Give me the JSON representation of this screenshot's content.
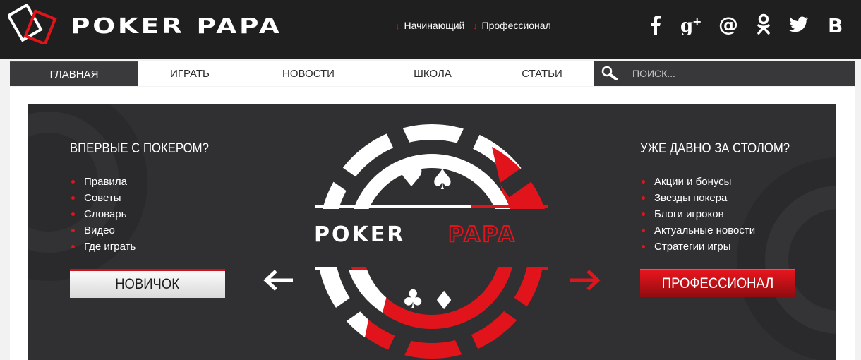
{
  "header": {
    "brand": "POKER PAPA",
    "links": [
      {
        "label": "Начинающий"
      },
      {
        "label": "Профессионал"
      }
    ],
    "social": [
      "facebook-icon",
      "google-plus-icon",
      "mail-at-icon",
      "odnoklassniki-icon",
      "twitter-icon",
      "vk-icon"
    ]
  },
  "nav": {
    "items": [
      {
        "label": "ГЛАВНАЯ",
        "active": true
      },
      {
        "label": "ИГРАТЬ"
      },
      {
        "label": "НОВОСТИ"
      },
      {
        "label": "ШКОЛА"
      },
      {
        "label": "СТАТЬИ"
      }
    ],
    "search_placeholder": "ПОИСК..."
  },
  "hero": {
    "left": {
      "title": "ВПЕРВЫЕ С ПОКЕРОМ?",
      "items": [
        "Правила",
        "Советы",
        "Словарь",
        "Видео",
        "Где играть"
      ],
      "button": "НОВИЧОК"
    },
    "center_logo": {
      "word1": "POKER",
      "word2": "PAPA"
    },
    "right": {
      "title": "УЖЕ ДАВНО ЗА СТОЛОМ?",
      "items": [
        "Акции и бонусы",
        "Звезды покера",
        "Блоги игроков",
        "Актуальные новости",
        "Стратегии игры"
      ],
      "button": "ПРОФЕССИОНАЛ"
    }
  },
  "colors": {
    "accent": "#e1131b",
    "header_bg": "#1f1f1f",
    "hero_bg": "#303032",
    "nav_dark": "#38383a"
  }
}
